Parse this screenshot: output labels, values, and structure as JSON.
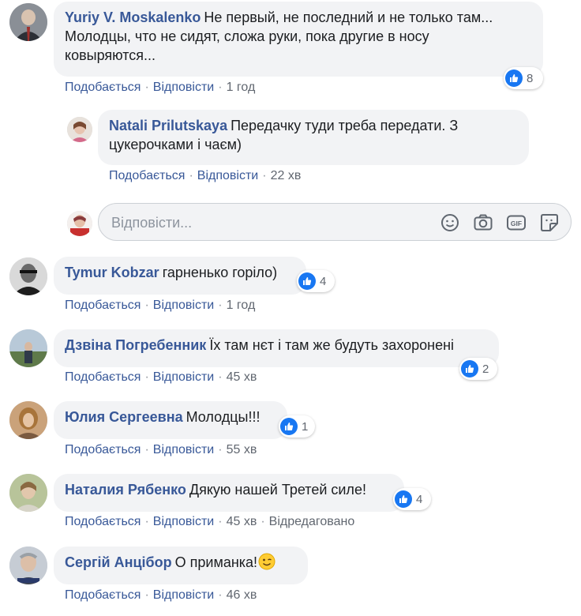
{
  "actions": {
    "like": "Подобається",
    "reply": "Відповісти",
    "sep": "·"
  },
  "reply_box": {
    "placeholder": "Відповісти..."
  },
  "comments": [
    {
      "author": "Yuriy V. Moskalenko",
      "text": "Не первый, не последний и не только там...",
      "text2": "Молодцы, что не сидят, сложа руки, пока другие в носу",
      "text3": "ковыряются...",
      "time": "1 год",
      "likes": "8"
    },
    {
      "author": "Natali Prilutskaya",
      "text": "Передачку туди треба передати. З",
      "text2": "цукерочками і чаєм)",
      "time": "22 хв"
    },
    {
      "author": "Tymur Kobzar",
      "text": "гарненько горіло)",
      "time": "1 год",
      "likes": "4"
    },
    {
      "author": "Дзвіна Погребенник",
      "text": "Їх там нєт і там же будуть захоронені",
      "time": "45 хв",
      "likes": "2"
    },
    {
      "author": "Юлия Сергеевна",
      "text": "Молодцы!!!",
      "time": "55 хв",
      "likes": "1"
    },
    {
      "author": "Наталия Рябенко",
      "text": "Дякую нашей Третей силе!",
      "time": "45 хв",
      "edited": "Відредаговано",
      "likes": "4"
    },
    {
      "author": "Сергій Анцібор",
      "text": "О приманка!",
      "time": "46 хв"
    }
  ]
}
